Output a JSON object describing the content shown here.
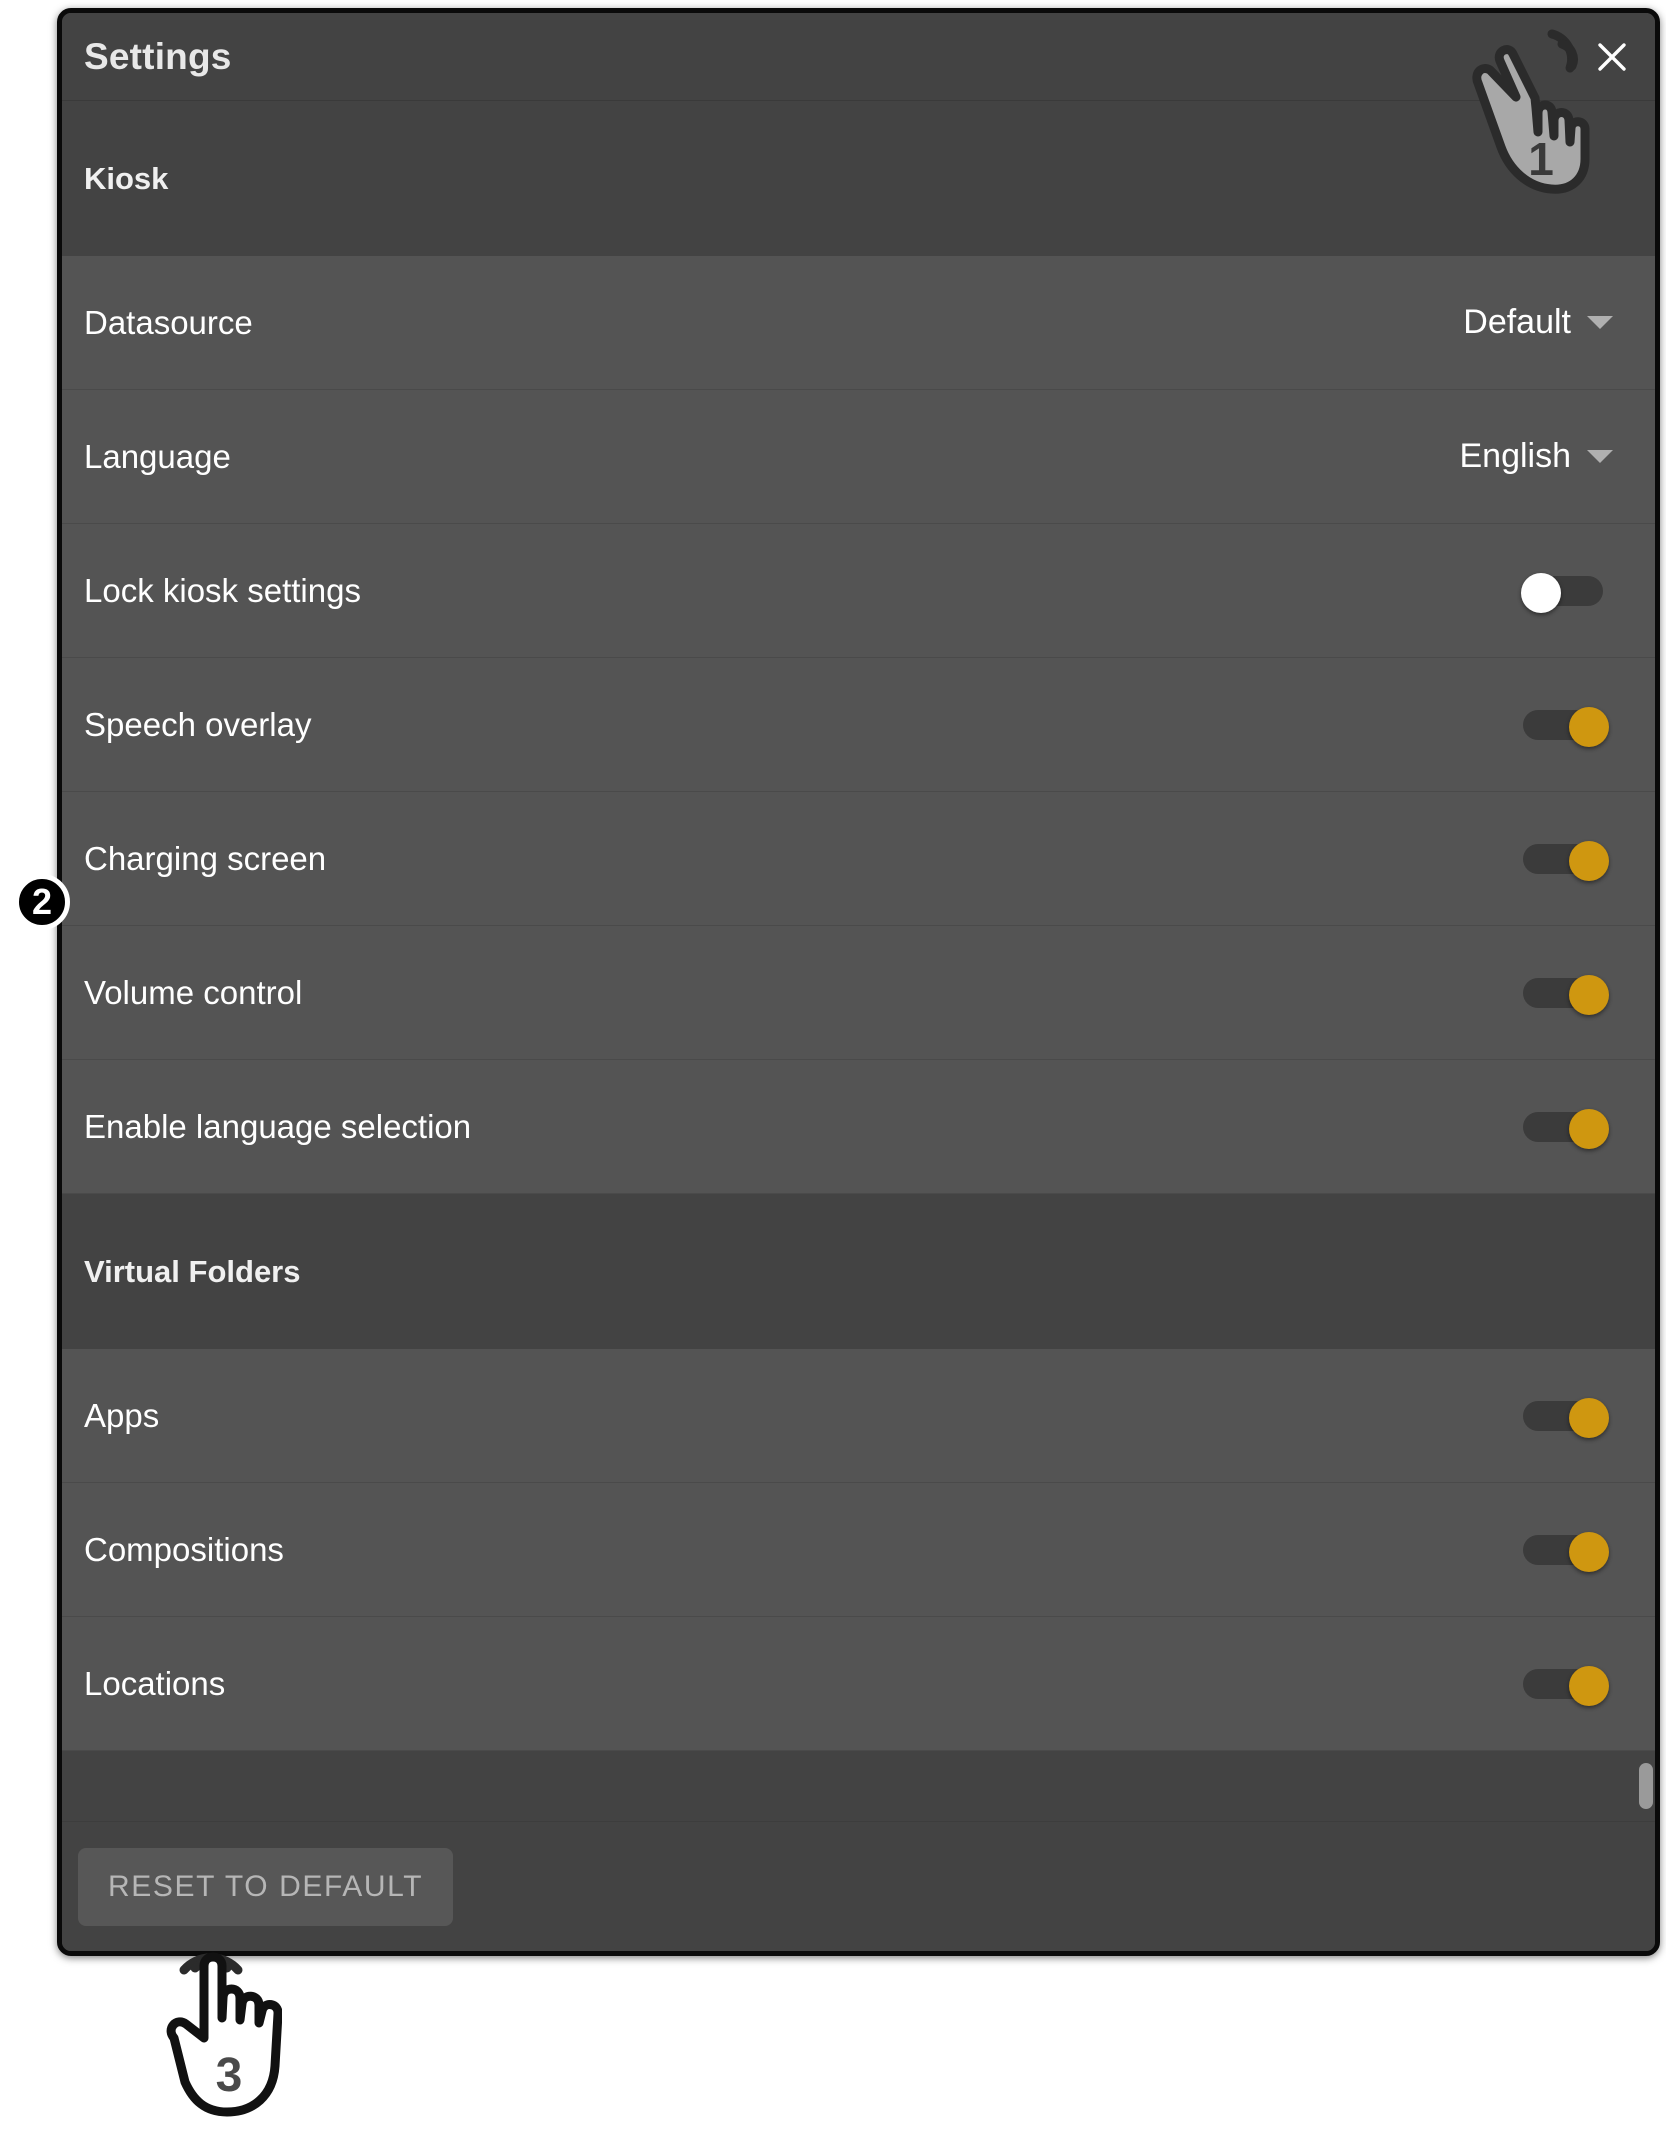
{
  "dialog": {
    "title": "Settings",
    "close_icon": "close-icon"
  },
  "sections": [
    {
      "header": "Kiosk",
      "rows": [
        {
          "label": "Datasource",
          "control": "dropdown",
          "value": "Default"
        },
        {
          "label": "Language",
          "control": "dropdown",
          "value": "English"
        },
        {
          "label": "Lock kiosk settings",
          "control": "toggle",
          "state": "off"
        },
        {
          "label": "Speech overlay",
          "control": "toggle",
          "state": "on"
        },
        {
          "label": "Charging screen",
          "control": "toggle",
          "state": "on"
        },
        {
          "label": "Volume control",
          "control": "toggle",
          "state": "on"
        },
        {
          "label": "Enable language selection",
          "control": "toggle",
          "state": "on"
        }
      ]
    },
    {
      "header": "Virtual Folders",
      "rows": [
        {
          "label": "Apps",
          "control": "toggle",
          "state": "on"
        },
        {
          "label": "Compositions",
          "control": "toggle",
          "state": "on"
        },
        {
          "label": "Locations",
          "control": "toggle",
          "state": "on"
        }
      ]
    }
  ],
  "footer": {
    "reset_label": "RESET TO DEFAULT"
  },
  "annotations": {
    "step1": "1",
    "step2": "2",
    "step3": "3"
  },
  "colors": {
    "toggle_on": "#cf9710",
    "toggle_off_knob": "#ffffff",
    "toggle_track": "#3b3b3b",
    "dialog_bg": "#4c4c4c",
    "row_bg": "#545454",
    "header_bg": "#434343",
    "text": "#ffffff"
  }
}
